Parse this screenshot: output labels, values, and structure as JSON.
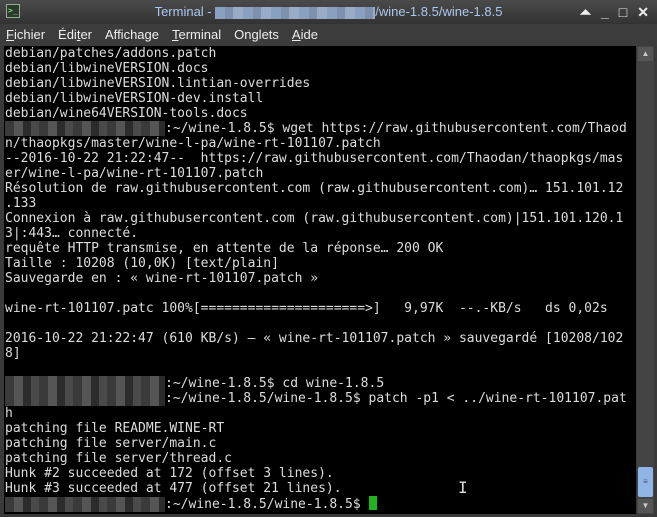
{
  "window": {
    "title_prefix": "Terminal - ",
    "title_suffix": "/wine-1.8.5/wine-1.8.5",
    "buttons": {
      "up": "⏶",
      "min": "_",
      "max": "□",
      "close": "✕"
    }
  },
  "menu": [
    {
      "key": "F",
      "rest": "ichier"
    },
    {
      "pre": "Édi",
      "key": "t",
      "rest": "er"
    },
    {
      "pre": "Affichage"
    },
    {
      "key": "T",
      "rest": "erminal"
    },
    {
      "pre": "Onglets"
    },
    {
      "key": "A",
      "rest": "ide"
    }
  ],
  "terminal": {
    "lines": [
      "debian/patches/addons.patch",
      "debian/libwineVERSION.docs",
      "debian/libwineVERSION.lintian-overrides",
      "debian/libwineVERSION-dev.install",
      "debian/wine64VERSION-tools.docs",
      ":~/wine-1.8.5$ wget https://raw.githubusercontent.com/Thaod",
      "n/thaopkgs/master/wine-l-pa/wine-rt-101107.patch",
      "--2016-10-22 21:22:47--  https://raw.githubusercontent.com/Thaodan/thaopkgs/mas",
      "er/wine-l-pa/wine-rt-101107.patch",
      "Résolution de raw.githubusercontent.com (raw.githubusercontent.com)… 151.101.12",
      ".133",
      "Connexion à raw.githubusercontent.com (raw.githubusercontent.com)|151.101.120.1",
      "3|:443… connecté.",
      "requête HTTP transmise, en attente de la réponse… 200 OK",
      "Taille : 10208 (10,0K) [text/plain]",
      "Sauvegarde en : « wine-rt-101107.patch »",
      "",
      "wine-rt-101107.patc 100%[=====================>]   9,97K  --.-KB/s   ds 0,02s",
      "",
      "2016-10-22 21:22:47 (610 KB/s) — « wine-rt-101107.patch » sauvegardé [10208/102",
      "8]",
      "",
      ":~/wine-1.8.5$ cd wine-1.8.5",
      ":~/wine-1.8.5/wine-1.8.5$ patch -p1 < ../wine-rt-101107.pat",
      "h",
      "patching file README.WINE-RT",
      "patching file server/main.c",
      "patching file server/thread.c",
      "Hunk #2 succeeded at 172 (offset 3 lines).",
      "Hunk #3 succeeded at 477 (offset 21 lines).",
      ":~/wine-1.8.5/wine-1.8.5$ "
    ],
    "blurred_prompt_lines": [
      5,
      22,
      23,
      30
    ],
    "cursor_color": "#1db51d"
  }
}
